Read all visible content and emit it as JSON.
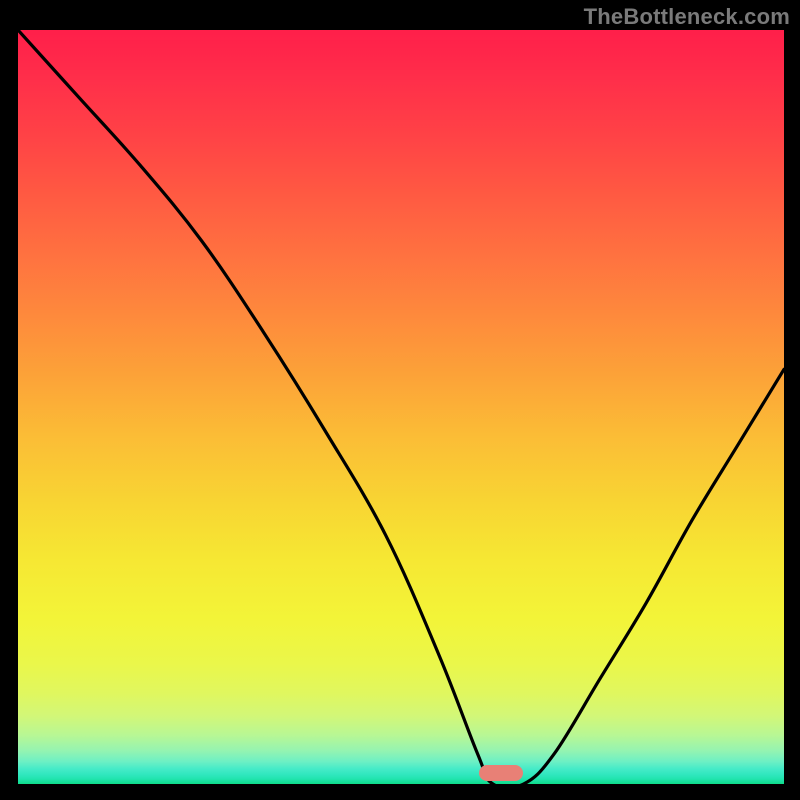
{
  "watermark": "TheBottleneck.com",
  "colors": {
    "background": "#000000",
    "curve": "#000000",
    "marker": "#e88076",
    "watermark_text": "#7a7a7a",
    "gradient_top": "#ff1f4a",
    "gradient_mid": "#f6e733",
    "gradient_bottom": "#0fdc89"
  },
  "chart_data": {
    "type": "line",
    "title": "",
    "xlabel": "",
    "ylabel": "",
    "xlim": [
      0,
      100
    ],
    "ylim": [
      0,
      100
    ],
    "grid": false,
    "legend": false,
    "series": [
      {
        "name": "bottleneck-curve",
        "x": [
          0,
          8,
          16,
          24,
          32,
          40,
          48,
          55,
          60,
          62,
          66,
          70,
          76,
          82,
          88,
          94,
          100
        ],
        "y": [
          100,
          91,
          82,
          72,
          60,
          47,
          33,
          17,
          4,
          0,
          0,
          4,
          14,
          24,
          35,
          45,
          55
        ]
      }
    ],
    "annotations": [
      {
        "name": "optimal-marker",
        "x": 63,
        "y": 1.5,
        "shape": "rounded-rect"
      }
    ],
    "background_gradient": {
      "direction": "vertical",
      "meaning": "red=high bottleneck, green=low bottleneck",
      "stops": [
        {
          "pos": 0.0,
          "color": "#ff1f4a"
        },
        {
          "pos": 0.5,
          "color": "#fca338"
        },
        {
          "pos": 0.78,
          "color": "#f3f438"
        },
        {
          "pos": 1.0,
          "color": "#0fdc89"
        }
      ]
    }
  }
}
